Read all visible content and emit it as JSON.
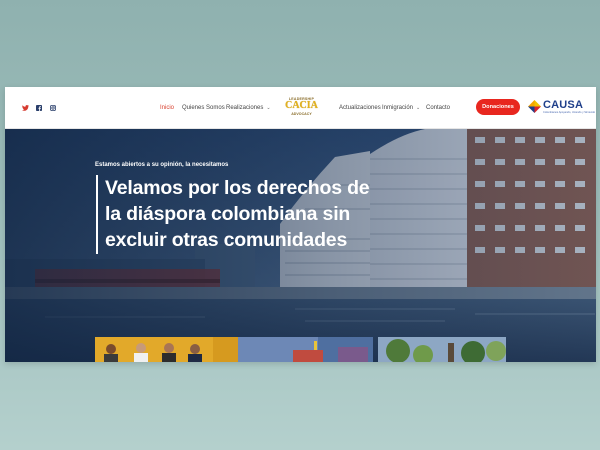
{
  "header": {
    "social": [
      "twitter-icon",
      "facebook-icon",
      "instagram-icon"
    ],
    "nav": [
      {
        "label": "Inicio",
        "active": true
      },
      {
        "label": "Quienes Somos"
      },
      {
        "label": "Realizaciones"
      },
      {
        "label": "Actualizaciones"
      },
      {
        "label": "Inmigración"
      },
      {
        "label": "Contacto"
      }
    ],
    "logo": {
      "top": "LEADERSHIP",
      "main": "CACIA",
      "bottom": "ADVOCACY"
    },
    "donate_label": "Donaciones",
    "partner_logo": {
      "name": "CAUSA",
      "tagline": "Colombianos Apoyando, Uniendo y Sirviendo"
    }
  },
  "hero": {
    "eyebrow": "Estamos abiertos a su opinión, la necesitamos",
    "headline": [
      "Velamos por los derechos de",
      "la diáspora colombiana sin",
      "excluir otras comunidades"
    ]
  },
  "colors": {
    "accent": "#e8271f",
    "nav_active": "#d9412f",
    "brand_blue": "#1f3f8a",
    "logo_gold": "#e2b21f",
    "page_background": "#9dbdba"
  }
}
